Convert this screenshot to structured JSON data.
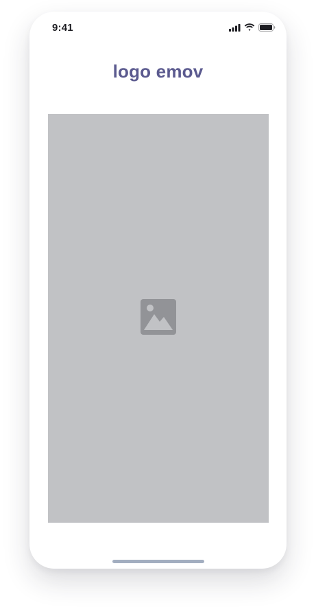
{
  "status_bar": {
    "time": "9:41",
    "icons": [
      "cellular-signal-icon",
      "wifi-icon",
      "battery-icon"
    ]
  },
  "header": {
    "logo_text": "logo emov"
  },
  "main": {
    "image_placeholder_icon": "image-icon"
  },
  "colors": {
    "logo": "#5b5a8f",
    "placeholder_bg": "#c1c2c5",
    "placeholder_icon": "#929397",
    "home_indicator": "#a3aec0"
  }
}
